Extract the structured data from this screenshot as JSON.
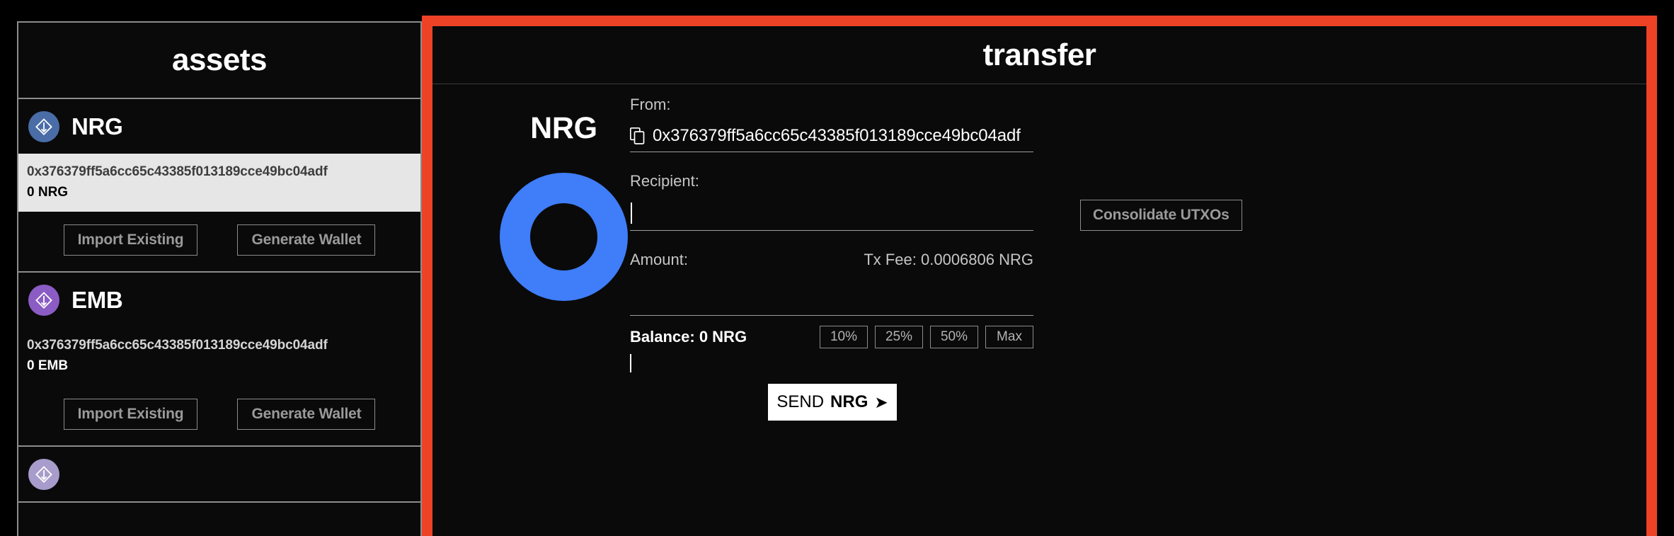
{
  "sidebar": {
    "title": "assets",
    "assets": [
      {
        "symbol": "NRG",
        "icon_name": "nrg-diamond-icon",
        "icon_color": "#4a6da7",
        "wallet_address": "0x376379ff5a6cc65c43385f013189cce49bc04adf",
        "wallet_balance": "0 NRG",
        "selected": true,
        "import_label": "Import Existing",
        "generate_label": "Generate Wallet"
      },
      {
        "symbol": "EMB",
        "icon_name": "emb-diamond-icon",
        "icon_color": "#8b5cc4",
        "wallet_address": "0x376379ff5a6cc65c43385f013189cce49bc04adf",
        "wallet_balance": "0 EMB",
        "selected": false,
        "import_label": "Import Existing",
        "generate_label": "Generate Wallet"
      }
    ],
    "partial_asset": {
      "icon_name": "third-asset-diamond-icon",
      "icon_color": "#a79ccb"
    }
  },
  "transfer": {
    "title": "transfer",
    "token": {
      "symbol": "NRG",
      "donut_color": "#3f7df9"
    },
    "from": {
      "label": "From:",
      "value": "0x376379ff5a6cc65c43385f013189cce49bc04adf",
      "copy_icon_name": "copy-icon"
    },
    "recipient": {
      "label": "Recipient:",
      "value": "",
      "placeholder": ""
    },
    "amount": {
      "label": "Amount:",
      "value": "",
      "placeholder": ""
    },
    "tx_fee": "Tx Fee: 0.0006806 NRG",
    "balance": "Balance: 0 NRG",
    "percent_buttons": [
      "10%",
      "25%",
      "50%",
      "Max"
    ],
    "send_button": {
      "word": "SEND",
      "token": "NRG",
      "arrow": "➤"
    },
    "consolidate_label": "Consolidate UTXOs",
    "accent_border_color": "#ee4226"
  }
}
